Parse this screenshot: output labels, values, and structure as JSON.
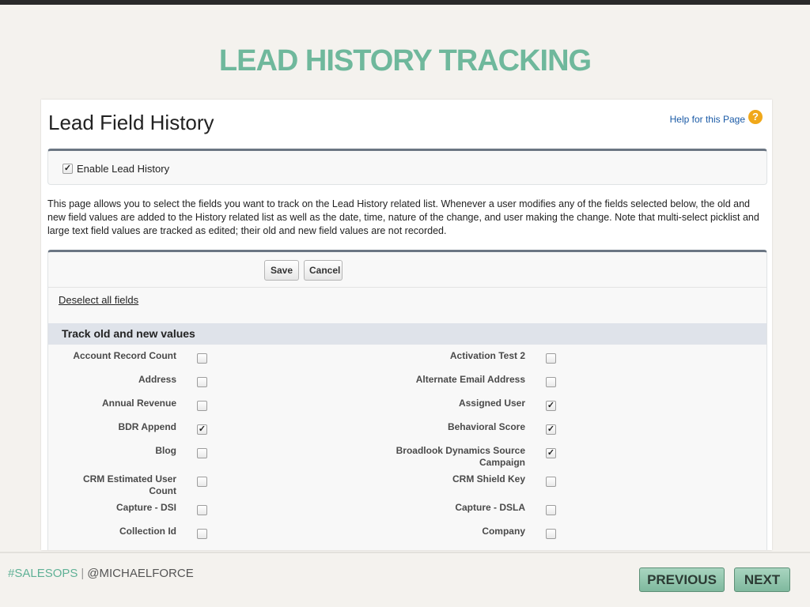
{
  "slide": {
    "title": "LEAD HISTORY TRACKING",
    "footer_hashtag": "#SALESOPS",
    "footer_separator": "|",
    "footer_handle": "@MICHAELFORCE",
    "prev_label": "PREVIOUS",
    "next_label": "NEXT"
  },
  "page": {
    "title": "Lead Field History",
    "help_link": "Help for this Page",
    "help_icon": "?",
    "enable_label": "Enable Lead History",
    "enable_checked": true,
    "description": "This page allows you to select the fields you want to track on the Lead History related list. Whenever a user modifies any of the fields selected below, the old and new field values are added to the History related list as well as the date, time, nature of the change, and user making the change. Note that multi-select picklist and large text field values are tracked as edited; their old and new field values are not recorded.",
    "save_label": "Save",
    "cancel_label": "Cancel",
    "deselect_label": "Deselect all fields",
    "section_title": "Track old and new values"
  },
  "fields": [
    {
      "left": {
        "label": "Account Record Count",
        "checked": false
      },
      "right": {
        "label": "Activation Test 2",
        "checked": false
      }
    },
    {
      "left": {
        "label": "Address",
        "checked": false
      },
      "right": {
        "label": "Alternate Email Address",
        "checked": false
      }
    },
    {
      "left": {
        "label": "Annual Revenue",
        "checked": false
      },
      "right": {
        "label": "Assigned User",
        "checked": true
      }
    },
    {
      "left": {
        "label": "BDR Append",
        "checked": true
      },
      "right": {
        "label": "Behavioral Score",
        "checked": true
      }
    },
    {
      "left": {
        "label": "Blog",
        "checked": false
      },
      "right": {
        "label": "Broadlook Dynamics Source Campaign",
        "checked": true
      }
    },
    {
      "left": {
        "label": "CRM Estimated User Count",
        "checked": false
      },
      "right": {
        "label": "CRM Shield Key",
        "checked": false
      }
    },
    {
      "left": {
        "label": "Capture - DSI",
        "checked": false
      },
      "right": {
        "label": "Capture - DSLA",
        "checked": false
      }
    },
    {
      "left": {
        "label": "Collection Id",
        "checked": false
      },
      "right": {
        "label": "Company",
        "checked": false
      }
    }
  ]
}
